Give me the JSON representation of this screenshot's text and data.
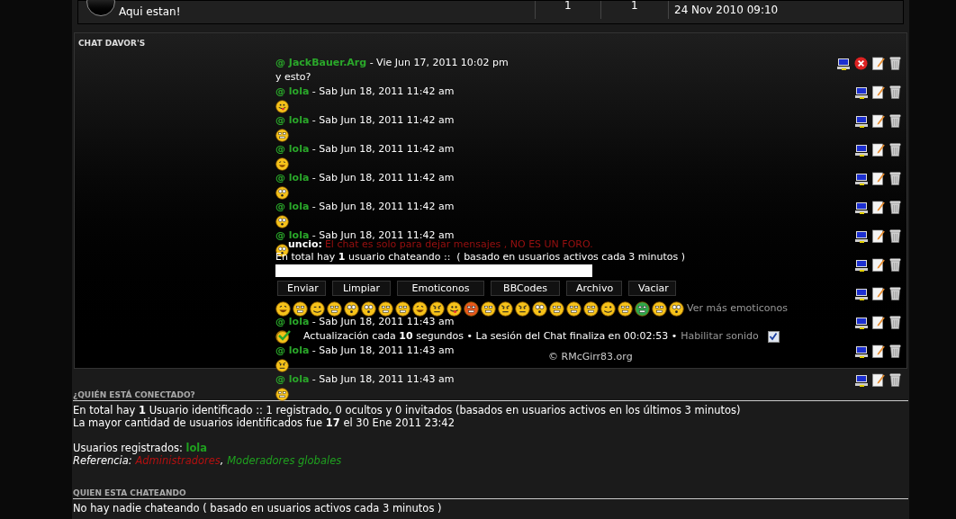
{
  "topic_row": {
    "title": "Aqui estan!",
    "column_2": "1",
    "column_3": "1",
    "last_post": "24 Nov 2010 09:10"
  },
  "chat": {
    "title": "CHAT DAVOR'S",
    "messages": [
      {
        "kind": "text",
        "user": "@ JackBauer.Arg",
        "date": " - Vie Jun 17, 2011 10:02 pm",
        "text": "y esto?",
        "can_ban": true
      },
      {
        "kind": "emoji",
        "user": "@ lola",
        "date": " - Sab Jun 18, 2011 11:42 am",
        "can_ban": false
      },
      {
        "kind": "emoji",
        "user": "@ lola",
        "date": " - Sab Jun 18, 2011 11:42 am",
        "can_ban": false
      },
      {
        "kind": "emoji",
        "user": "@ lola",
        "date": " - Sab Jun 18, 2011 11:42 am",
        "can_ban": false
      },
      {
        "kind": "emoji",
        "user": "@ lola",
        "date": " - Sab Jun 18, 2011 11:42 am",
        "can_ban": false
      },
      {
        "kind": "emoji",
        "user": "@ lola",
        "date": " - Sab Jun 18, 2011 11:42 am",
        "can_ban": false
      },
      {
        "kind": "emoji",
        "user": "@ lola",
        "date": " - Sab Jun 18, 2011 11:42 am",
        "can_ban": false
      },
      {
        "kind": "covered",
        "can_ban": false
      },
      {
        "kind": "covered",
        "can_ban": false
      },
      {
        "kind": "emoji",
        "user": "@ lola",
        "date": " - Sab Jun 18, 2011 11:43 am",
        "can_ban": false
      },
      {
        "kind": "emoji",
        "user": "@ lola",
        "date": " - Sab Jun 18, 2011 11:43 am",
        "can_ban": false
      },
      {
        "kind": "emoji",
        "user": "@ lola",
        "date": " - Sab Jun 18, 2011 11:43 am",
        "can_ban": false
      }
    ],
    "panel": {
      "notice_label": "uncio:",
      "notice": "El chat es solo para dejar mensajes , NO ES UN FORO.",
      "online": "En total hay **1** usuario chateando ::  ( basado en usuarios activos cada 3 minutos )",
      "buttons": [
        "Enviar",
        "Limpiar",
        "Emoticonos",
        "BBCodes",
        "Archivo",
        "Vaciar"
      ],
      "smileys": [
        {
          "color": "#f6c21a"
        },
        {
          "color": "#f6c21a"
        },
        {
          "color": "#f6c21a"
        },
        {
          "color": "#f6c21a"
        },
        {
          "color": "#f6c21a"
        },
        {
          "color": "#f6c21a"
        },
        {
          "color": "#f6c21a"
        },
        {
          "color": "#f6c21a"
        },
        {
          "color": "#f6c21a"
        },
        {
          "color": "#f6c21a"
        },
        {
          "color": "#f6c21a"
        },
        {
          "color": "#e8581c"
        },
        {
          "color": "#f6c21a"
        },
        {
          "color": "#f6c21a"
        },
        {
          "color": "#f6c21a"
        },
        {
          "color": "#f6c21a"
        },
        {
          "color": "#f6c21a"
        },
        {
          "color": "#f6c21a"
        },
        {
          "color": "#f6c21a"
        },
        {
          "color": "#f6c21a"
        },
        {
          "color": "#f6c21a"
        },
        {
          "color": "#2fa84a"
        },
        {
          "color": "#f6c21a"
        },
        {
          "color": "#f6c21a"
        }
      ],
      "more_link": "Ver más emoticonos",
      "status": "Actualización cada **10** segundos • La sesión del Chat finaliza en 00:02:53 •",
      "sound_label": "Habilitar sonido",
      "sound_checked": true,
      "credit": "© RMcGirr83.org"
    }
  },
  "who_is_online": {
    "title": "¿QUIÉN ESTÁ CONECTADO?",
    "line_1": "En total hay **1** Usuario identificado :: 1 registrado, 0 ocultos y 0 invitados (basados en usuarios activos en los últimos 3 minutos)",
    "line_2": "La mayor cantidad de usuarios identificados fue **17** el 30 Ene 2011 23:42",
    "registered_label": "Usuarios registrados: ",
    "registered_user": "lola",
    "legend_label": "Referencia: ",
    "legend_separator": ", ",
    "legend": [
      {
        "label": "Administradores",
        "color": "#b41010"
      },
      {
        "label": "Moderadores globales",
        "color": "#1fa01f"
      }
    ]
  },
  "who_is_chatting": {
    "title": "QUIEN ESTA CHATEANDO",
    "text": "No hay nadie chateando ( basado en usuarios activos cada 3 minutos )"
  }
}
